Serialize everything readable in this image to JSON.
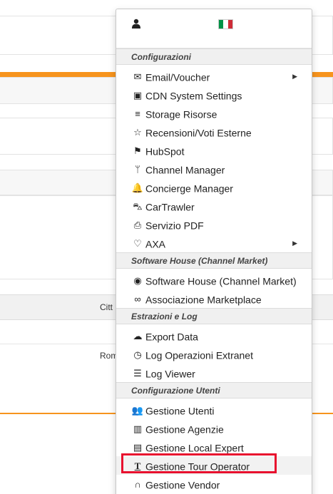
{
  "background": {
    "table_header_city": "Citt",
    "table_row_city": "Rom"
  },
  "dropdown": {
    "user_icon": "user-icon",
    "language_flag": "italy-flag",
    "sections": [
      {
        "title": "Configurazioni",
        "items": [
          {
            "icon": "envelope-icon",
            "label": "Email/Voucher",
            "submenu": true
          },
          {
            "icon": "image-icon",
            "label": "CDN System Settings",
            "submenu": false
          },
          {
            "icon": "database-icon",
            "label": "Storage Risorse",
            "submenu": false
          },
          {
            "icon": "star-icon",
            "label": "Recensioni/Voti Esterne",
            "submenu": false
          },
          {
            "icon": "hubspot-icon",
            "label": "HubSpot",
            "submenu": false
          },
          {
            "icon": "fork-icon",
            "label": "Channel Manager",
            "submenu": false
          },
          {
            "icon": "bell-icon",
            "label": "Concierge Manager",
            "submenu": false
          },
          {
            "icon": "car-icon",
            "label": "CarTrawler",
            "submenu": false
          },
          {
            "icon": "pdf-icon",
            "label": "Servizio PDF",
            "submenu": false
          },
          {
            "icon": "heart-icon",
            "label": "AXA",
            "submenu": true
          }
        ]
      },
      {
        "title": "Software House (Channel Market)",
        "items": [
          {
            "icon": "dot-circle-icon",
            "label": "Software House (Channel Market)",
            "submenu": false
          },
          {
            "icon": "link-icon",
            "label": "Associazione Marketplace",
            "submenu": false
          }
        ]
      },
      {
        "title": "Estrazioni e Log",
        "items": [
          {
            "icon": "cloud-download-icon",
            "label": "Export Data",
            "submenu": false
          },
          {
            "icon": "dashboard-icon",
            "label": "Log Operazioni Extranet",
            "submenu": false
          },
          {
            "icon": "list-icon",
            "label": "Log Viewer",
            "submenu": false
          }
        ]
      },
      {
        "title": "Configurazione Utenti",
        "items": [
          {
            "icon": "users-icon",
            "label": "Gestione Utenti",
            "submenu": false
          },
          {
            "icon": "building-icon",
            "label": "Gestione Agenzie",
            "submenu": false
          },
          {
            "icon": "id-card-icon",
            "label": "Gestione Local Expert",
            "submenu": false
          },
          {
            "icon": "text-icon",
            "label": "Gestione Tour Operator",
            "submenu": false,
            "highlighted": true
          },
          {
            "icon": "headphones-icon",
            "label": "Gestione Vendor",
            "submenu": false
          }
        ]
      }
    ]
  },
  "colors": {
    "accent_orange": "#f7941d",
    "highlight_red": "#e8102e"
  }
}
